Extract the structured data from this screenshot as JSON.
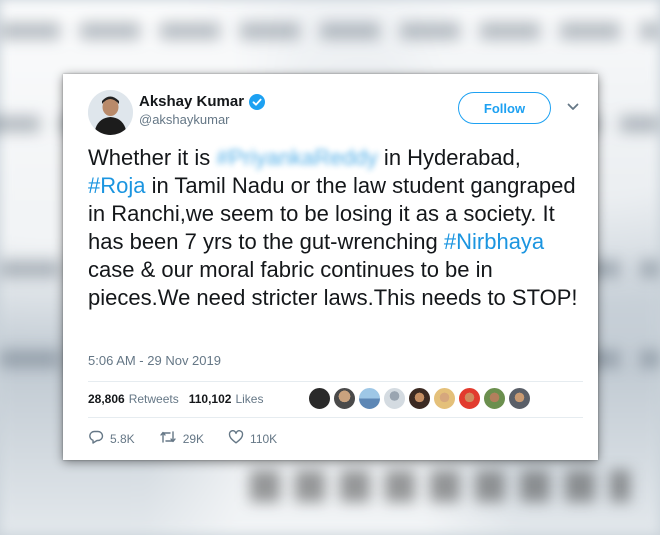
{
  "tweet": {
    "display_name": "Akshay Kumar",
    "handle": "@akshaykumar",
    "follow_label": "Follow",
    "text": {
      "part1": "Whether it is ",
      "blurred_hashtag": "#PriyankaReddy",
      "part2": " in Hyderabad, ",
      "hashtag1": "#Roja",
      "part3": " in Tamil Nadu or the law student gangraped in Ranchi,we seem to be losing it as a society. It has been 7 yrs to the gut-wrenching ",
      "hashtag2": "#Nirbhaya",
      "part4": " case & our moral fabric continues to be in pieces.We need stricter laws.This needs to STOP!"
    },
    "timestamp": "5:06 AM - 29 Nov 2019",
    "retweets_count": "28,806",
    "retweets_label": "Retweets",
    "likes_count": "110,102",
    "likes_label": "Likes",
    "reply_count": "5.8K",
    "retweet_action_count": "29K",
    "like_action_count": "110K"
  },
  "colors": {
    "accent": "#1da1f2",
    "hashtag": "#1b95e0",
    "text": "#14171a",
    "muted": "#657786"
  },
  "icons": [
    "verified-badge-icon",
    "chevron-down-icon",
    "reply-icon",
    "retweet-icon",
    "like-icon"
  ]
}
